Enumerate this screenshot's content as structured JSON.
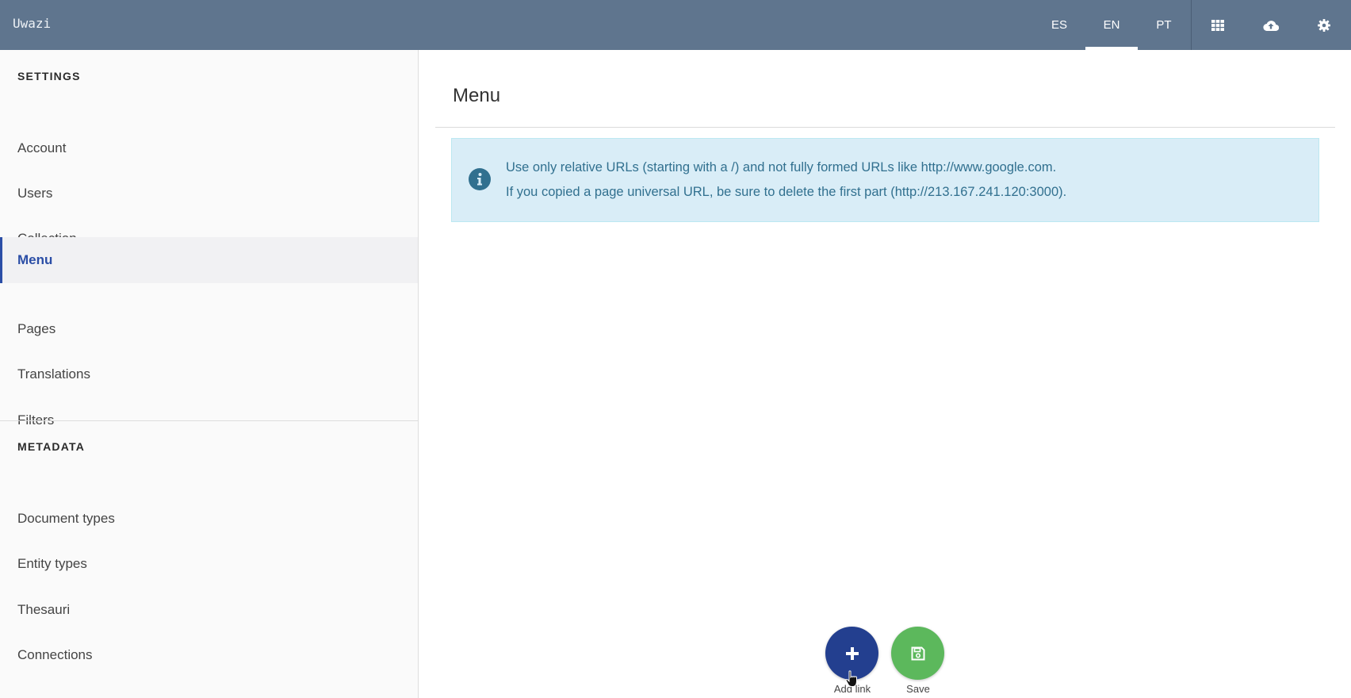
{
  "app": {
    "title": "Uwazi"
  },
  "topbar": {
    "languages": [
      {
        "code": "ES",
        "active": false
      },
      {
        "code": "EN",
        "active": true
      },
      {
        "code": "PT",
        "active": false
      }
    ],
    "icons": [
      "grid-icon",
      "cloud-upload-icon",
      "gear-icon"
    ]
  },
  "sidebar": {
    "settings_heading": "SETTINGS",
    "settings_items": [
      {
        "label": "Account"
      },
      {
        "label": "Users"
      },
      {
        "label": "Collection"
      },
      {
        "label": "Menu",
        "active": true
      },
      {
        "label": "Pages"
      },
      {
        "label": "Translations"
      },
      {
        "label": "Filters"
      }
    ],
    "metadata_heading": "METADATA",
    "metadata_items": [
      {
        "label": "Document types"
      },
      {
        "label": "Entity types"
      },
      {
        "label": "Thesauri"
      },
      {
        "label": "Connections"
      }
    ]
  },
  "main": {
    "title": "Menu",
    "alert": {
      "line1": "Use only relative URLs (starting with a /) and not fully formed URLs like http://www.google.com.",
      "line2": "If you copied a page universal URL, be sure to delete the first part (http://213.167.241.120:3000)."
    }
  },
  "actions": {
    "add_label": "Add link",
    "save_label": "Save"
  },
  "colors": {
    "topbar": "#5f758e",
    "accent": "#2b4ea6",
    "add_button": "#233f8f",
    "save_button": "#5cb85c",
    "alert_bg": "#d9edf7",
    "alert_text": "#31708f"
  }
}
